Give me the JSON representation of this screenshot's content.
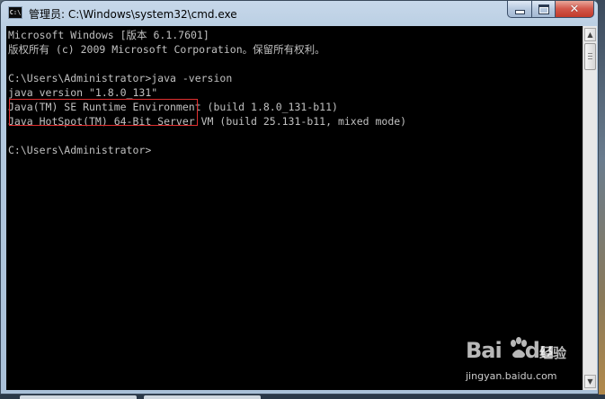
{
  "window": {
    "title": "管理员: C:\\Windows\\system32\\cmd.exe",
    "icon": "cmd-icon",
    "icon_text": "C:\\",
    "controls": {
      "minimize": "minimize-icon",
      "maximize": "maximize-icon",
      "close": "✕"
    }
  },
  "console": {
    "lines": [
      "Microsoft Windows [版本 6.1.7601]",
      "版权所有 (c) 2009 Microsoft Corporation。保留所有权利。",
      "",
      "C:\\Users\\Administrator>java -version",
      "java version \"1.8.0_131\"",
      "Java(TM) SE Runtime Environment (build 1.8.0_131-b11)",
      "Java HotSpot(TM) 64-Bit Server VM (build 25.131-b11, mixed mode)",
      "",
      "C:\\Users\\Administrator>"
    ],
    "text_color": "#c0c0c0",
    "background": "#000000",
    "highlight_color": "#e03030"
  },
  "scrollbar": {
    "up_arrow": "▲",
    "down_arrow": "▼"
  },
  "watermark": {
    "logo_text": "Bai",
    "logo_suffix": "du",
    "sub_text": "经验",
    "url": "jingyan.baidu.com"
  }
}
